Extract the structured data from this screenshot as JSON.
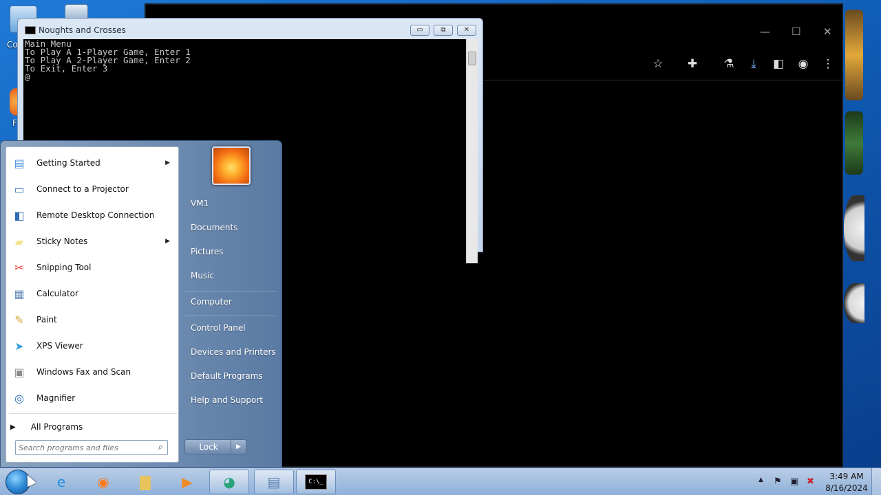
{
  "desktop": {
    "icons": [
      {
        "label": "Co",
        "icon": "computer-icon"
      },
      {
        "label": "F",
        "icon": "firefox-icon"
      }
    ]
  },
  "chrome": {
    "controls": {
      "minimize": "—",
      "maximize": "☐",
      "close": "✕"
    },
    "toolbar_icons": [
      "star-icon",
      "extensions-icon",
      "labs-icon",
      "download-icon",
      "sidepanel-icon",
      "profile-icon",
      "menu-icon"
    ]
  },
  "console": {
    "title": "Noughts and Crosses",
    "lines": "Main Menu\nTo Play A 1-Player Game, Enter 1\nTo Play A 2-Player Game, Enter 2\nTo Exit, Enter 3\n@",
    "buttons": {
      "minimize": "▭",
      "restore": "⧉",
      "close": "✕"
    }
  },
  "startmenu": {
    "programs": [
      {
        "label": "Getting Started",
        "icon": "getting-started-icon",
        "submenu": true,
        "glyph": "▤",
        "color": "#4a90d9"
      },
      {
        "label": "Connect to a Projector",
        "icon": "projector-icon",
        "submenu": false,
        "glyph": "▭",
        "color": "#3b7bc8"
      },
      {
        "label": "Remote Desktop Connection",
        "icon": "remote-desktop-icon",
        "submenu": false,
        "glyph": "◧",
        "color": "#2f6db5"
      },
      {
        "label": "Sticky Notes",
        "icon": "sticky-notes-icon",
        "submenu": true,
        "glyph": "▰",
        "color": "#f3e38a"
      },
      {
        "label": "Snipping Tool",
        "icon": "snipping-tool-icon",
        "submenu": false,
        "glyph": "✂",
        "color": "#e04040"
      },
      {
        "label": "Calculator",
        "icon": "calculator-icon",
        "submenu": false,
        "glyph": "▦",
        "color": "#6a8fb8"
      },
      {
        "label": "Paint",
        "icon": "paint-icon",
        "submenu": false,
        "glyph": "✎",
        "color": "#d4a63a"
      },
      {
        "label": "XPS Viewer",
        "icon": "xps-viewer-icon",
        "submenu": false,
        "glyph": "➤",
        "color": "#3b9fd9"
      },
      {
        "label": "Windows Fax and Scan",
        "icon": "fax-scan-icon",
        "submenu": false,
        "glyph": "▣",
        "color": "#8c8c8c"
      },
      {
        "label": "Magnifier",
        "icon": "magnifier-icon",
        "submenu": false,
        "glyph": "◎",
        "color": "#2c6fb8"
      }
    ],
    "all_programs": "All Programs",
    "search_placeholder": "Search programs and files",
    "places": [
      {
        "label": "VM1",
        "name": "startmenu-user-vm1"
      },
      {
        "label": "Documents",
        "name": "startmenu-documents"
      },
      {
        "label": "Pictures",
        "name": "startmenu-pictures"
      },
      {
        "label": "Music",
        "name": "startmenu-music"
      },
      {
        "label": "Computer",
        "name": "startmenu-computer"
      },
      {
        "label": "Control Panel",
        "name": "startmenu-control-panel"
      },
      {
        "label": "Devices and Printers",
        "name": "startmenu-devices-printers"
      },
      {
        "label": "Default Programs",
        "name": "startmenu-default-programs"
      },
      {
        "label": "Help and Support",
        "name": "startmenu-help-support"
      }
    ],
    "lock_label": "Lock"
  },
  "taskbar": {
    "apps": [
      {
        "name": "taskbar-ie",
        "icon": "internet-explorer-icon",
        "glyph": "e",
        "color": "#1f8fe0",
        "active": false
      },
      {
        "name": "taskbar-firefox",
        "icon": "firefox-icon",
        "glyph": "◉",
        "color": "#ff7a1a",
        "active": false
      },
      {
        "name": "taskbar-explorer",
        "icon": "folder-icon",
        "glyph": "▇",
        "color": "#e8c25a",
        "active": false
      },
      {
        "name": "taskbar-media-player",
        "icon": "media-player-icon",
        "glyph": "▶",
        "color": "#f08a24",
        "active": false
      },
      {
        "name": "taskbar-chrome",
        "icon": "chrome-icon",
        "glyph": "◕",
        "color": "#2aa37a",
        "active": true
      },
      {
        "name": "taskbar-notepad",
        "icon": "notepad-icon",
        "glyph": "▤",
        "color": "#5a7fb0",
        "active": true
      },
      {
        "name": "taskbar-cmd",
        "icon": "console-icon",
        "glyph": "C:\\_",
        "color": "#000000",
        "active": true
      }
    ],
    "tray_icons": [
      "show-hidden-icon",
      "flag-icon",
      "network-icon",
      "volume-muted-icon"
    ],
    "time": "3:49 AM",
    "date": "8/16/2024"
  }
}
